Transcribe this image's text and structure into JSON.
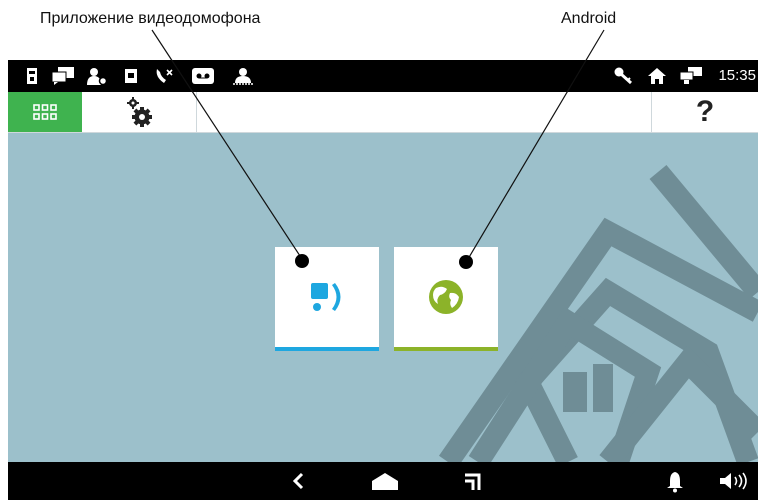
{
  "callouts": {
    "app": "Приложение видеодомофона",
    "android": "Android"
  },
  "status_bar": {
    "left_icons": [
      "sd-card-icon",
      "messages-icon",
      "user-settings-icon",
      "screen-icon",
      "missed-call-icon",
      "voicemail-icon",
      "do-not-disturb-icon"
    ],
    "right_icons": [
      "key-icon",
      "home-icon",
      "network-icon"
    ],
    "time": "15:35"
  },
  "toolbar": {
    "apps_icon": "grid-icon",
    "settings_icon": "gears-icon",
    "help_label": "?"
  },
  "tiles": [
    {
      "name": "intercom-app",
      "icon": "intercom-icon",
      "accent": "#1ea7e0"
    },
    {
      "name": "android",
      "icon": "globe-icon",
      "accent": "#8cb329"
    }
  ],
  "nav_bar": {
    "buttons": [
      "back-icon",
      "home-icon",
      "recents-icon",
      "notification-bell-icon",
      "volume-icon"
    ]
  },
  "colors": {
    "wallpaper": "#9cc0cb",
    "wallpaper_pattern": "#6f8d96",
    "apps_button": "#3fb34f",
    "intercom_accent": "#1ea7e0",
    "android_accent": "#8cb329"
  }
}
